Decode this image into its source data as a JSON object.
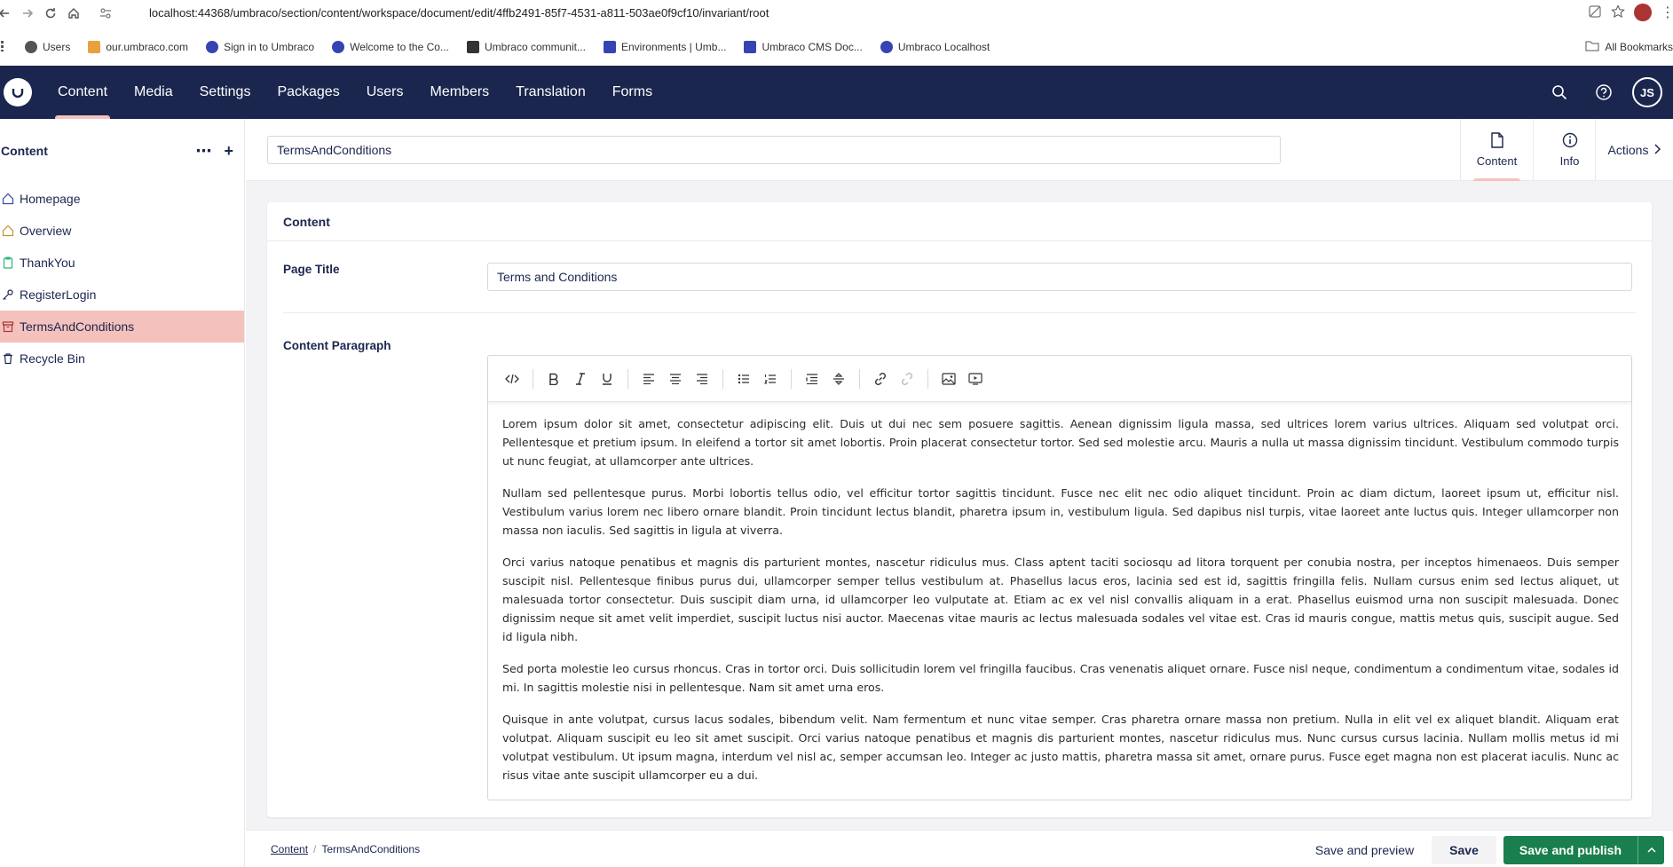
{
  "browser": {
    "url": "localhost:44368/umbraco/section/content/workspace/document/edit/4ffb2491-85f7-4531-a811-503ae0f9cf10/invariant/root",
    "bookmarks": [
      "Users",
      "our.umbraco.com",
      "Sign in to Umbraco",
      "Welcome to the Co...",
      "Umbraco communit...",
      "Environments | Umb...",
      "Umbraco CMS Doc...",
      "Umbraco Localhost"
    ],
    "all_bookmarks": "All Bookmarks"
  },
  "header": {
    "sections": [
      "Content",
      "Media",
      "Settings",
      "Packages",
      "Users",
      "Members",
      "Translation",
      "Forms"
    ],
    "active_section": "Content",
    "avatar_initials": "JS"
  },
  "sidebar": {
    "title": "Content",
    "items": [
      {
        "label": "Homepage",
        "icon": "home-icon"
      },
      {
        "label": "Overview",
        "icon": "home-icon"
      },
      {
        "label": "ThankYou",
        "icon": "clipboard-icon"
      },
      {
        "label": "RegisterLogin",
        "icon": "key-icon"
      },
      {
        "label": "TermsAndConditions",
        "icon": "archive-icon",
        "active": true
      },
      {
        "label": "Recycle Bin",
        "icon": "trash-icon"
      }
    ]
  },
  "document": {
    "name": "TermsAndConditions",
    "tabs": {
      "content": "Content",
      "info": "Info"
    },
    "actions": "Actions",
    "group_title": "Content",
    "page_title_label": "Page Title",
    "page_title_value": "Terms and Conditions",
    "paragraph_label": "Content Paragraph",
    "paragraphs": [
      "Lorem ipsum dolor sit amet, consectetur adipiscing elit. Duis ut dui nec sem posuere sagittis. Aenean dignissim ligula massa, sed ultrices lorem varius ultrices. Aliquam sed volutpat orci. Pellentesque et pretium ipsum. In eleifend a tortor sit amet lobortis. Proin placerat consectetur tortor. Sed sed molestie arcu. Mauris a nulla ut massa dignissim tincidunt. Vestibulum commodo turpis ut nunc feugiat, at ullamcorper ante ultrices.",
      "Nullam sed pellentesque purus. Morbi lobortis tellus odio, vel efficitur tortor sagittis tincidunt. Fusce nec elit nec odio aliquet tincidunt. Proin ac diam dictum, laoreet ipsum ut, efficitur nisl. Vestibulum varius lorem nec libero ornare blandit. Proin tincidunt lectus blandit, pharetra ipsum in, vestibulum ligula. Sed dapibus nisl turpis, vitae laoreet ante luctus quis. Integer ullamcorper non massa non iaculis. Sed sagittis in ligula at viverra.",
      "Orci varius natoque penatibus et magnis dis parturient montes, nascetur ridiculus mus. Class aptent taciti sociosqu ad litora torquent per conubia nostra, per inceptos himenaeos. Duis semper suscipit nisl. Pellentesque finibus purus dui, ullamcorper semper tellus vestibulum at. Phasellus lacus eros, lacinia sed est id, sagittis fringilla felis. Nullam cursus enim sed lectus aliquet, ut malesuada tortor consectetur. Duis suscipit diam urna, id ullamcorper leo vulputate at. Etiam ac ex vel nisl convallis aliquam in a erat. Phasellus euismod urna non suscipit malesuada. Donec dignissim neque sit amet velit imperdiet, suscipit luctus nisi auctor. Maecenas vitae mauris ac lectus malesuada sodales vel vitae est. Cras id mauris congue, mattis metus quis, suscipit augue. Sed id ligula nibh.",
      "Sed porta molestie leo cursus rhoncus. Cras in tortor orci. Duis sollicitudin lorem vel fringilla faucibus. Cras venenatis aliquet ornare. Fusce nisl neque, condimentum a condimentum vitae, sodales id mi. In sagittis molestie nisi in pellentesque. Nam sit amet urna eros.",
      "Quisque in ante volutpat, cursus lacus sodales, bibendum velit. Nam fermentum et nunc vitae semper. Cras pharetra ornare massa non pretium. Nulla in elit vel ex aliquet blandit. Aliquam erat volutpat. Aliquam suscipit eu leo sit amet suscipit. Orci varius natoque penatibus et magnis dis parturient montes, nascetur ridiculus mus. Nunc cursus cursus lacinia. Nullam mollis metus id mi volutpat vestibulum. Ut ipsum magna, interdum vel nisl ac, semper accumsan leo. Integer ac justo mattis, pharetra massa sit amet, ornare purus. Fusce eget magna non est placerat iaculis. Nunc ac risus vitae ante suscipit ullamcorper eu a dui."
    ]
  },
  "footer": {
    "breadcrumb_root": "Content",
    "breadcrumb_current": "TermsAndConditions",
    "save_preview": "Save and preview",
    "save": "Save",
    "save_publish": "Save and publish"
  },
  "colors": {
    "header_bg": "#1b264f",
    "active_accent": "#f5c1bc",
    "publish_green": "#1a7f4e"
  }
}
